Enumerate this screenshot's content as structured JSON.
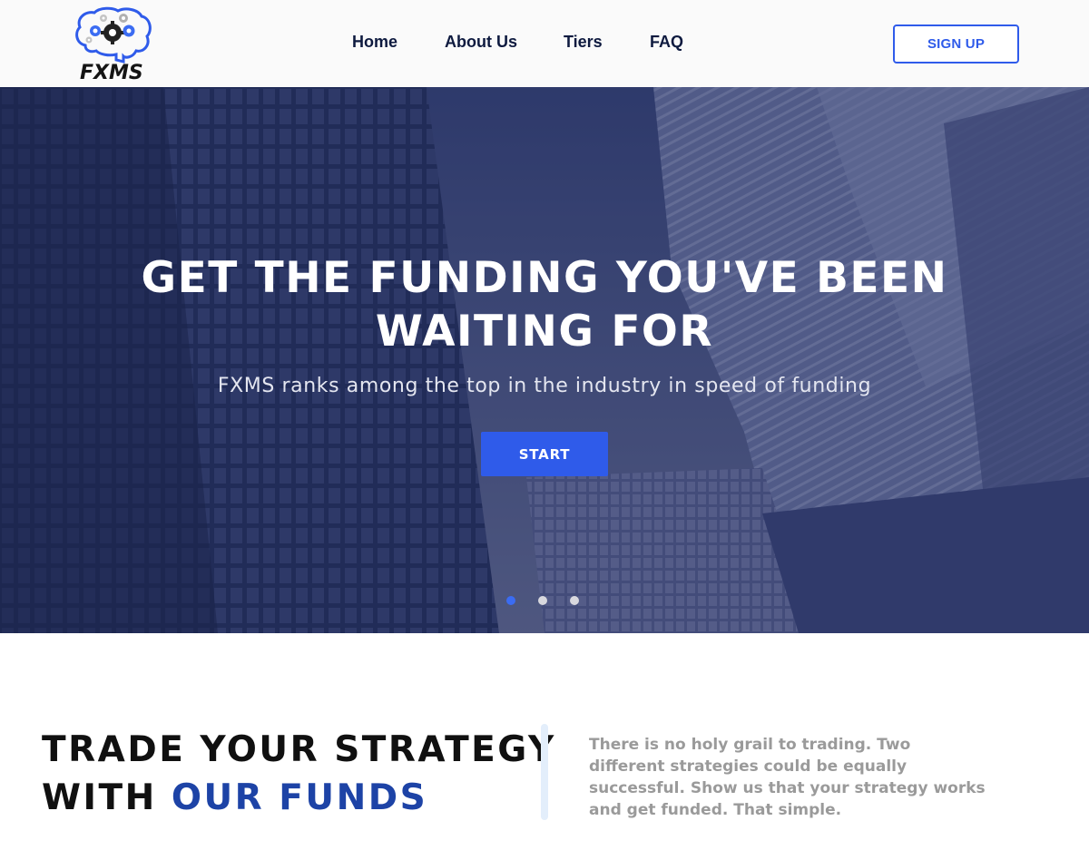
{
  "brand": {
    "logo_text": "FXMS"
  },
  "nav": {
    "items": [
      {
        "label": "Home"
      },
      {
        "label": "About Us"
      },
      {
        "label": "Tiers"
      },
      {
        "label": "FAQ"
      }
    ],
    "signup_label": "SIGN UP"
  },
  "hero": {
    "title_line1": "GET THE FUNDING YOU'VE BEEN",
    "title_line2": "WAITING FOR",
    "subtitle": "FXMS ranks among the top in the industry in speed of funding",
    "cta_label": "START",
    "slides": {
      "count": 3,
      "active_index": 0
    }
  },
  "section": {
    "heading_line1": "TRADE YOUR STRATEGY",
    "heading_line2_plain": "WITH ",
    "heading_line2_accent": "OUR FUNDS",
    "blurb": "There is no holy grail to trading. Two different strategies could be equally successful. Show us that your strategy works and get funded. That simple."
  },
  "colors": {
    "accent_blue": "#2f5bea",
    "heading_accent": "#1d43a6",
    "nav_text": "#0e1a3f",
    "hero_overlay": "#1f2a52",
    "blurb_gray": "#9a9a9a"
  }
}
